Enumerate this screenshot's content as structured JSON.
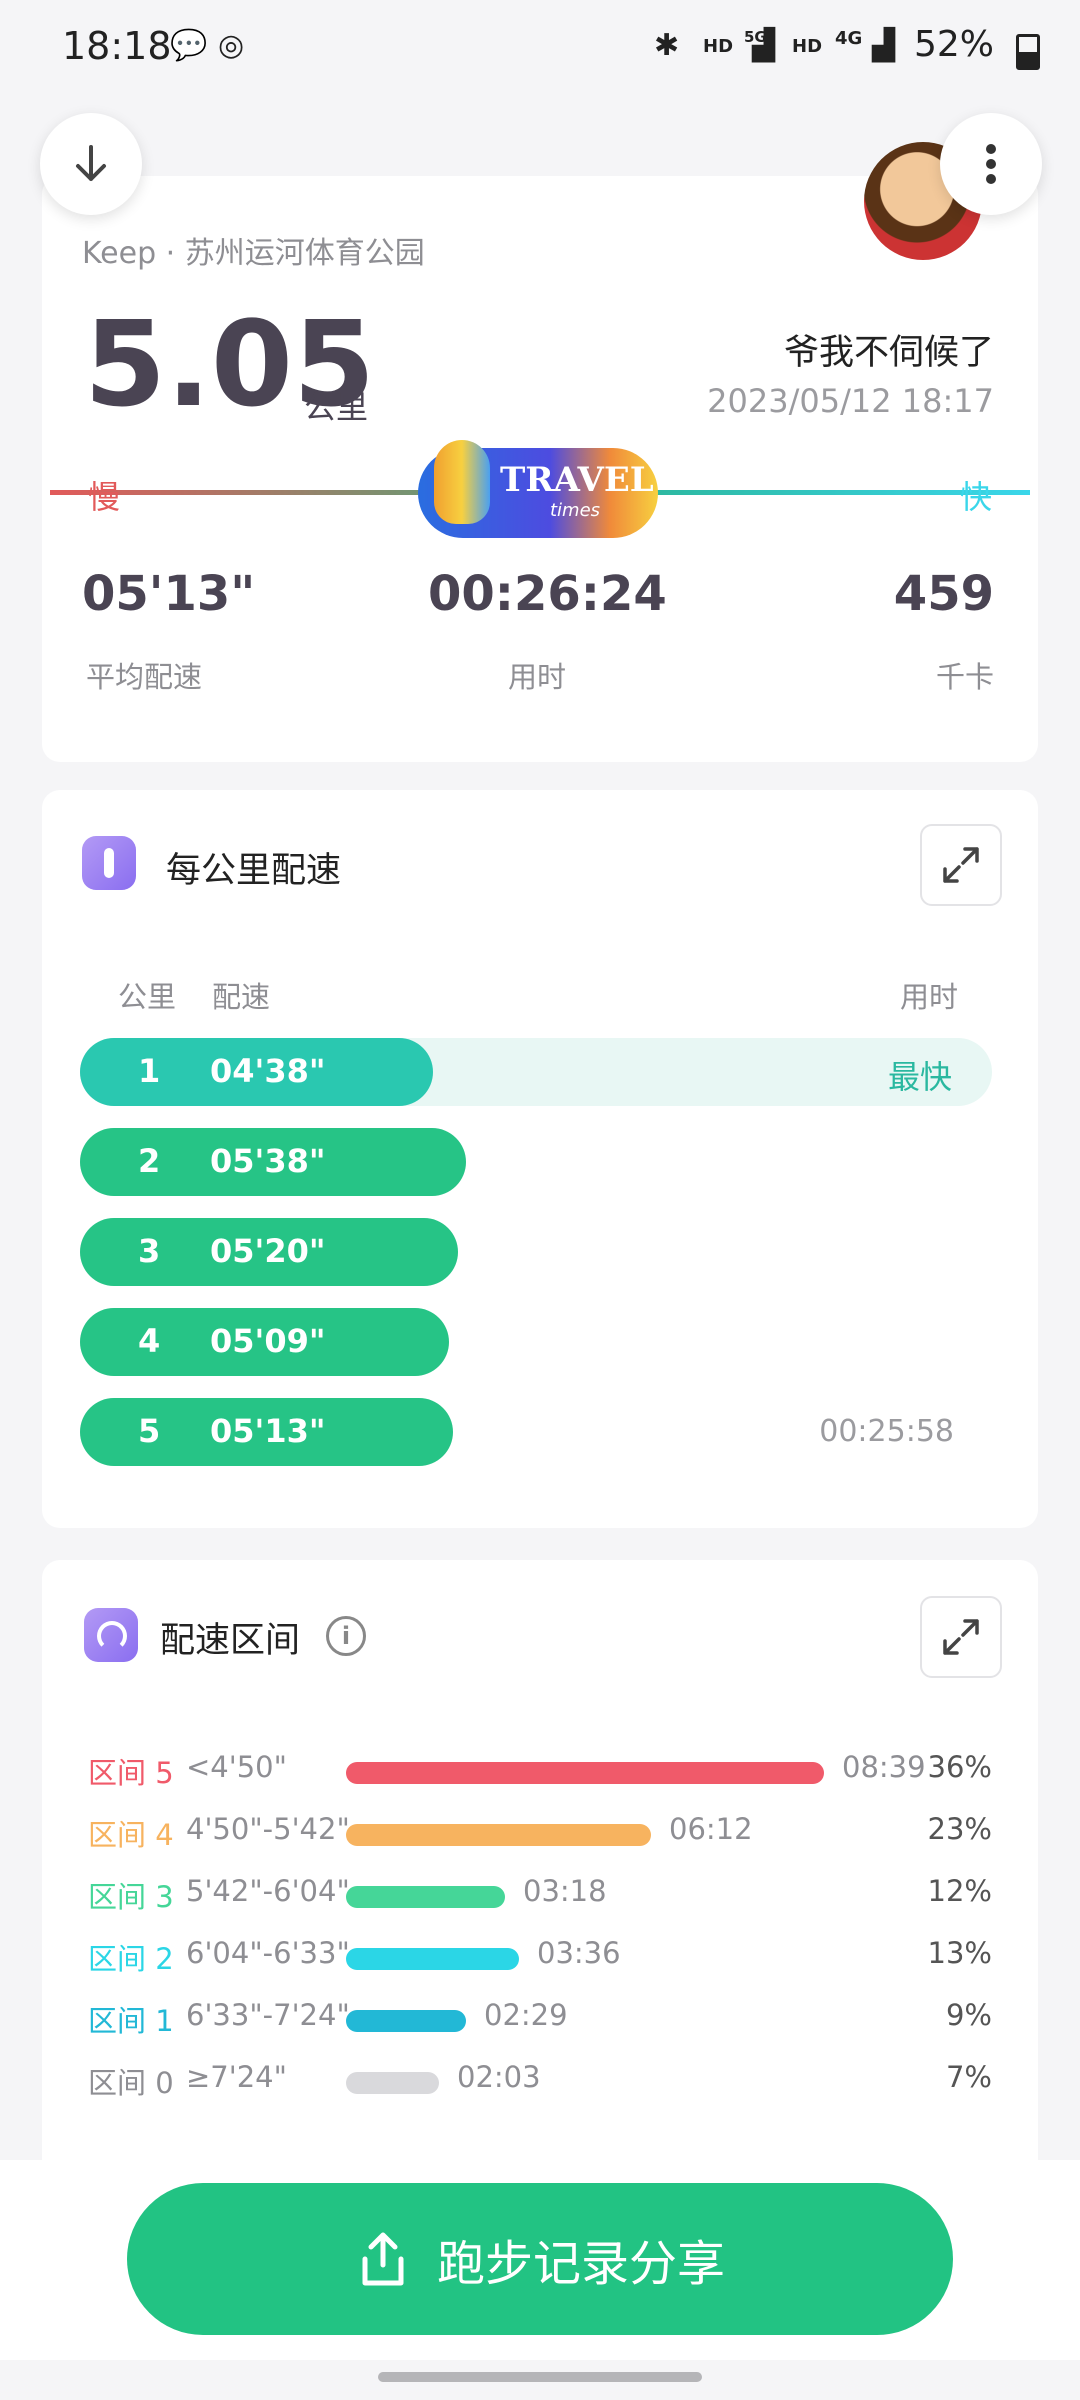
{
  "status_bar": {
    "time": "18:18",
    "battery": "52%",
    "tags": [
      "HD",
      "5G",
      "HD",
      "4G"
    ]
  },
  "summary": {
    "source": "Keep · 苏州运河体育公园",
    "distance": "5.05",
    "distance_unit": "公里",
    "user_name": "爷我不伺候了",
    "datetime": "2023/05/12 18:17",
    "slow_label": "慢",
    "fast_label": "快",
    "logo_text": "TRAVEL",
    "logo_sub": "times",
    "stats": [
      {
        "value": "05'13\"",
        "label": "平均配速"
      },
      {
        "value": "00:26:24",
        "label": "用时"
      },
      {
        "value": "459",
        "label": "千卡"
      }
    ]
  },
  "pace_per_km": {
    "title": "每公里配速",
    "col_km": "公里",
    "col_pace": "配速",
    "col_time": "用时",
    "fastest_label": "最快",
    "rows": [
      {
        "km": "1",
        "pace": "04'38\"",
        "fraction": 0.43,
        "time": ""
      },
      {
        "km": "2",
        "pace": "05'38\"",
        "fraction": 0.47,
        "time": ""
      },
      {
        "km": "3",
        "pace": "05'20\"",
        "fraction": 0.46,
        "time": ""
      },
      {
        "km": "4",
        "pace": "05'09\"",
        "fraction": 0.45,
        "time": ""
      },
      {
        "km": "5",
        "pace": "05'13\"",
        "fraction": 0.455,
        "time": "00:25:58"
      }
    ]
  },
  "pace_zones": {
    "title": "配速区间",
    "zones": [
      {
        "name": "区间 5",
        "range": "<4'50\"",
        "time": "08:39",
        "percent": "36%",
        "fraction": 0.36,
        "color": "#f05a6a"
      },
      {
        "name": "区间 4",
        "range": "4'50\"-5'42\"",
        "time": "06:12",
        "percent": "23%",
        "fraction": 0.23,
        "color": "#f7b35f"
      },
      {
        "name": "区间 3",
        "range": "5'42\"-6'04\"",
        "time": "03:18",
        "percent": "12%",
        "fraction": 0.12,
        "color": "#45d698"
      },
      {
        "name": "区间 2",
        "range": "6'04\"-6'33\"",
        "time": "03:36",
        "percent": "13%",
        "fraction": 0.13,
        "color": "#2bd6e6"
      },
      {
        "name": "区间 1",
        "range": "6'33\"-7'24\"",
        "time": "02:29",
        "percent": "9%",
        "fraction": 0.09,
        "color": "#22b8d6"
      },
      {
        "name": "区间 0",
        "range": "≥7'24\"",
        "time": "02:03",
        "percent": "7%",
        "fraction": 0.07,
        "color": "#d9d9dc"
      }
    ]
  },
  "share": {
    "label": "跑步记录分享"
  },
  "colors": {
    "accent": "#22c383",
    "pace_bar": "#26c486",
    "fastest_bar": "#2ac8b0"
  }
}
